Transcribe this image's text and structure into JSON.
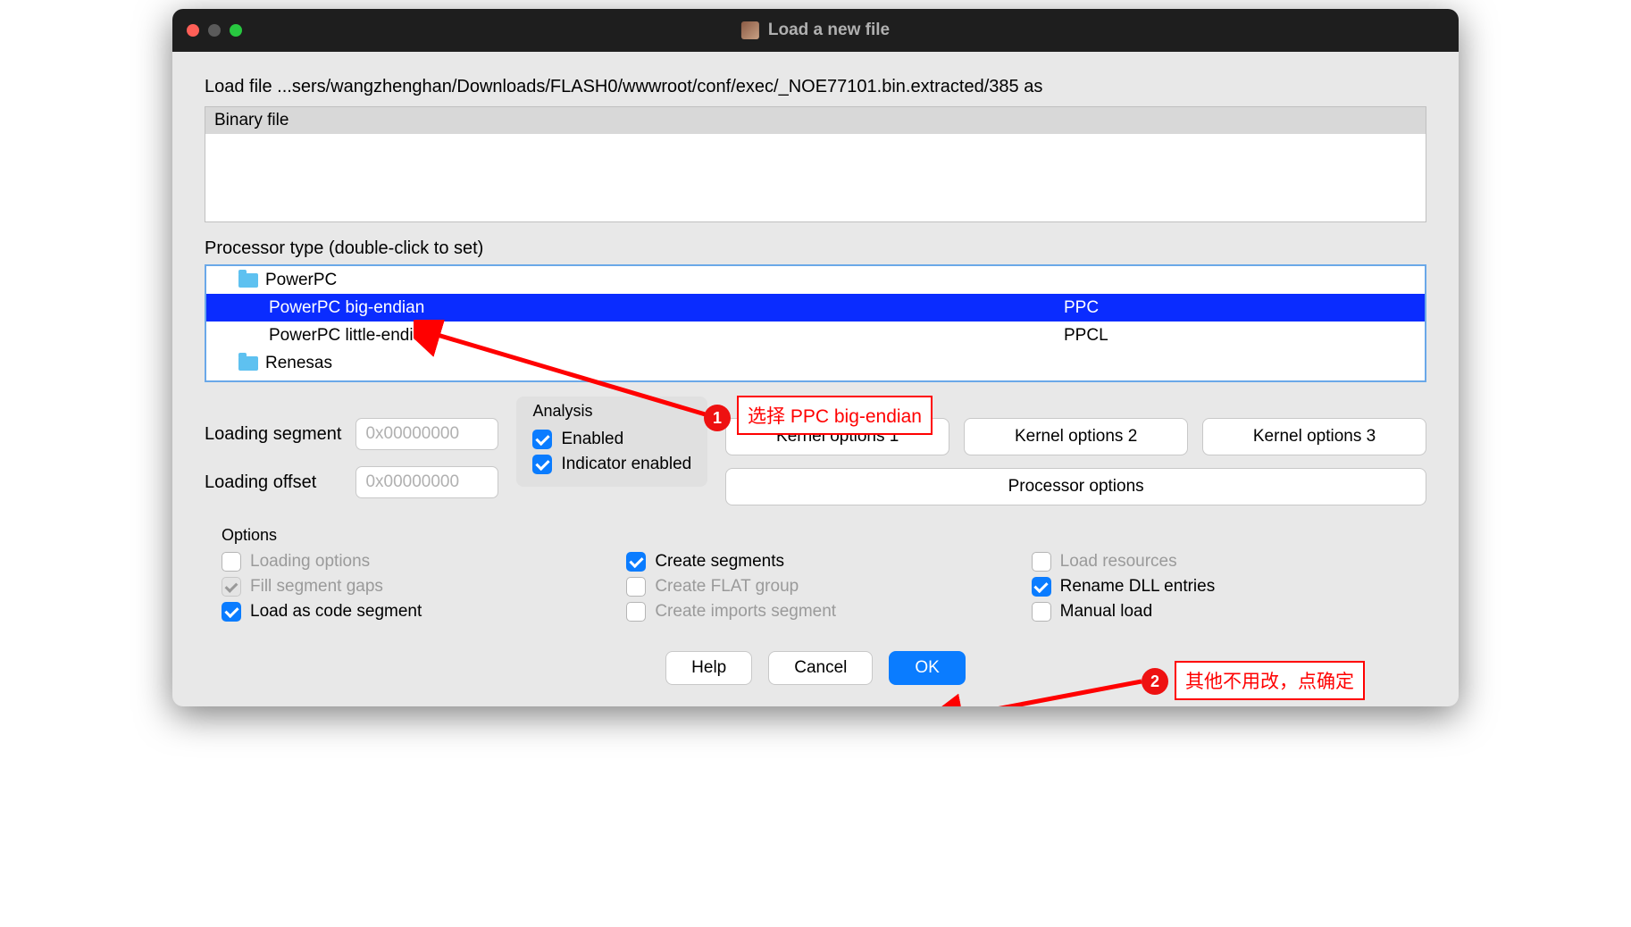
{
  "window": {
    "title": "Load a new file"
  },
  "loadpath": "Load file ...sers/wangzhenghan/Downloads/FLASH0/wwwroot/conf/exec/_NOE77101.bin.extracted/385 as",
  "filebox": {
    "header": "Binary file"
  },
  "processor": {
    "label": "Processor type (double-click to set)",
    "groups": [
      {
        "name": "PowerPC",
        "items": [
          {
            "name": "PowerPC big-endian",
            "code": "PPC",
            "selected": true
          },
          {
            "name": "PowerPC little-endian",
            "code": "PPCL",
            "selected": false
          }
        ]
      },
      {
        "name": "Renesas",
        "items": []
      }
    ]
  },
  "loading": {
    "segment_label": "Loading segment",
    "segment_value": "0x00000000",
    "offset_label": "Loading offset",
    "offset_value": "0x00000000"
  },
  "analysis": {
    "title": "Analysis",
    "enabled_label": "Enabled",
    "indicator_label": "Indicator enabled"
  },
  "buttons": {
    "kernel1": "Kernel options 1",
    "kernel2": "Kernel options 2",
    "kernel3": "Kernel options 3",
    "processor": "Processor options"
  },
  "options": {
    "title": "Options",
    "loading_options": "Loading options",
    "fill_gaps": "Fill segment gaps",
    "load_code": "Load as code segment",
    "create_seg": "Create segments",
    "create_flat": "Create FLAT group",
    "create_imports": "Create imports segment",
    "load_res": "Load resources",
    "rename_dll": "Rename DLL entries",
    "manual_load": "Manual load"
  },
  "footer": {
    "help": "Help",
    "cancel": "Cancel",
    "ok": "OK"
  },
  "annotations": {
    "a1_badge": "1",
    "a1_text": "选择 PPC big-endian",
    "a2_badge": "2",
    "a2_text": "其他不用改，点确定"
  }
}
